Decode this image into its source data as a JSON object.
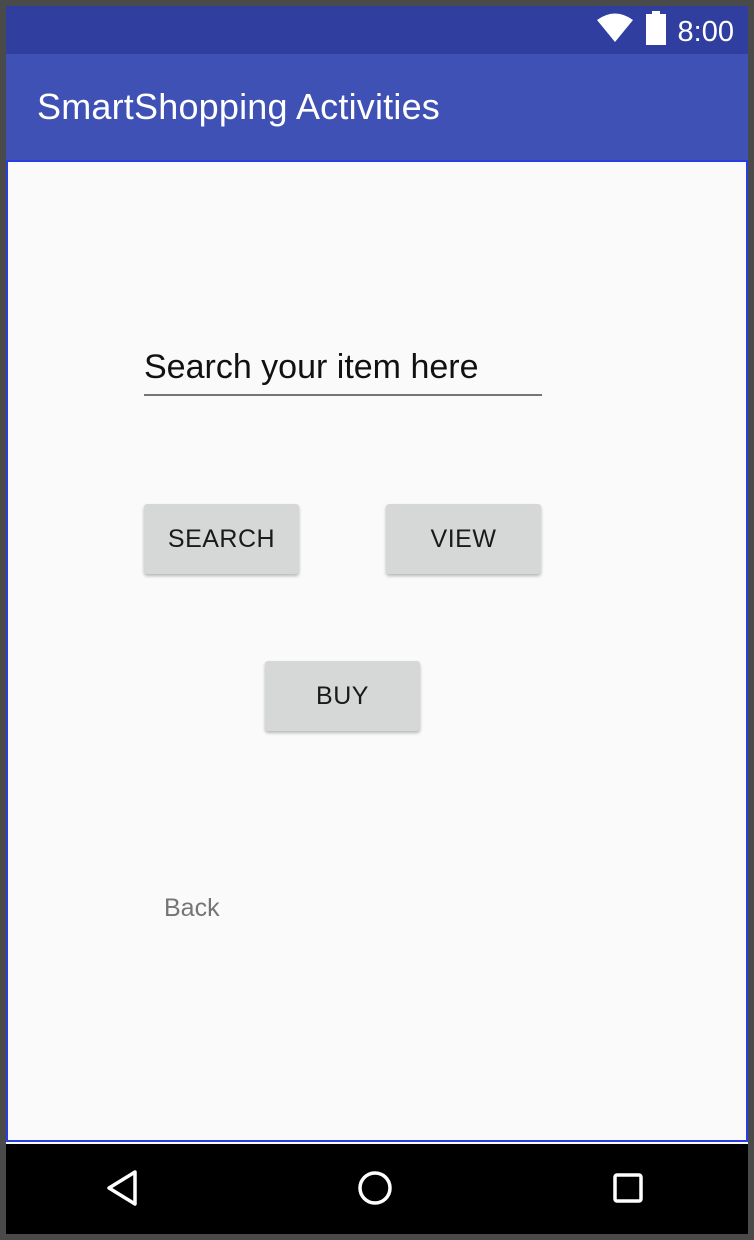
{
  "status_bar": {
    "time": "8:00",
    "icons": [
      "wifi-icon",
      "battery-icon"
    ]
  },
  "app_bar": {
    "title": "SmartShopping Activities"
  },
  "search": {
    "placeholder": "Search your item here"
  },
  "buttons": {
    "search_label": "SEARCH",
    "view_label": "VIEW",
    "buy_label": "BUY"
  },
  "back_link": {
    "label": "Back"
  },
  "nav_bar": {
    "icons": [
      "back-icon",
      "home-icon",
      "recents-icon"
    ]
  },
  "colors": {
    "status_bar": "#303f9f",
    "app_bar": "#3f51b5",
    "button_bg": "#d6d7d7",
    "background": "#fafafa"
  }
}
